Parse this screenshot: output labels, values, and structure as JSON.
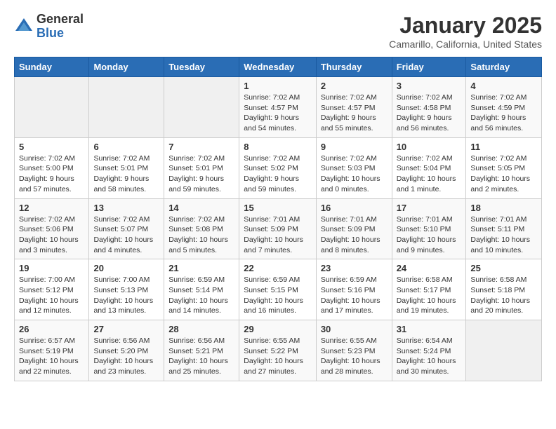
{
  "logo": {
    "general": "General",
    "blue": "Blue"
  },
  "header": {
    "title": "January 2025",
    "location": "Camarillo, California, United States"
  },
  "days_of_week": [
    "Sunday",
    "Monday",
    "Tuesday",
    "Wednesday",
    "Thursday",
    "Friday",
    "Saturday"
  ],
  "weeks": [
    [
      {
        "day": "",
        "info": ""
      },
      {
        "day": "",
        "info": ""
      },
      {
        "day": "",
        "info": ""
      },
      {
        "day": "1",
        "info": "Sunrise: 7:02 AM\nSunset: 4:57 PM\nDaylight: 9 hours\nand 54 minutes."
      },
      {
        "day": "2",
        "info": "Sunrise: 7:02 AM\nSunset: 4:57 PM\nDaylight: 9 hours\nand 55 minutes."
      },
      {
        "day": "3",
        "info": "Sunrise: 7:02 AM\nSunset: 4:58 PM\nDaylight: 9 hours\nand 56 minutes."
      },
      {
        "day": "4",
        "info": "Sunrise: 7:02 AM\nSunset: 4:59 PM\nDaylight: 9 hours\nand 56 minutes."
      }
    ],
    [
      {
        "day": "5",
        "info": "Sunrise: 7:02 AM\nSunset: 5:00 PM\nDaylight: 9 hours\nand 57 minutes."
      },
      {
        "day": "6",
        "info": "Sunrise: 7:02 AM\nSunset: 5:01 PM\nDaylight: 9 hours\nand 58 minutes."
      },
      {
        "day": "7",
        "info": "Sunrise: 7:02 AM\nSunset: 5:01 PM\nDaylight: 9 hours\nand 59 minutes."
      },
      {
        "day": "8",
        "info": "Sunrise: 7:02 AM\nSunset: 5:02 PM\nDaylight: 9 hours\nand 59 minutes."
      },
      {
        "day": "9",
        "info": "Sunrise: 7:02 AM\nSunset: 5:03 PM\nDaylight: 10 hours\nand 0 minutes."
      },
      {
        "day": "10",
        "info": "Sunrise: 7:02 AM\nSunset: 5:04 PM\nDaylight: 10 hours\nand 1 minute."
      },
      {
        "day": "11",
        "info": "Sunrise: 7:02 AM\nSunset: 5:05 PM\nDaylight: 10 hours\nand 2 minutes."
      }
    ],
    [
      {
        "day": "12",
        "info": "Sunrise: 7:02 AM\nSunset: 5:06 PM\nDaylight: 10 hours\nand 3 minutes."
      },
      {
        "day": "13",
        "info": "Sunrise: 7:02 AM\nSunset: 5:07 PM\nDaylight: 10 hours\nand 4 minutes."
      },
      {
        "day": "14",
        "info": "Sunrise: 7:02 AM\nSunset: 5:08 PM\nDaylight: 10 hours\nand 5 minutes."
      },
      {
        "day": "15",
        "info": "Sunrise: 7:01 AM\nSunset: 5:09 PM\nDaylight: 10 hours\nand 7 minutes."
      },
      {
        "day": "16",
        "info": "Sunrise: 7:01 AM\nSunset: 5:09 PM\nDaylight: 10 hours\nand 8 minutes."
      },
      {
        "day": "17",
        "info": "Sunrise: 7:01 AM\nSunset: 5:10 PM\nDaylight: 10 hours\nand 9 minutes."
      },
      {
        "day": "18",
        "info": "Sunrise: 7:01 AM\nSunset: 5:11 PM\nDaylight: 10 hours\nand 10 minutes."
      }
    ],
    [
      {
        "day": "19",
        "info": "Sunrise: 7:00 AM\nSunset: 5:12 PM\nDaylight: 10 hours\nand 12 minutes."
      },
      {
        "day": "20",
        "info": "Sunrise: 7:00 AM\nSunset: 5:13 PM\nDaylight: 10 hours\nand 13 minutes."
      },
      {
        "day": "21",
        "info": "Sunrise: 6:59 AM\nSunset: 5:14 PM\nDaylight: 10 hours\nand 14 minutes."
      },
      {
        "day": "22",
        "info": "Sunrise: 6:59 AM\nSunset: 5:15 PM\nDaylight: 10 hours\nand 16 minutes."
      },
      {
        "day": "23",
        "info": "Sunrise: 6:59 AM\nSunset: 5:16 PM\nDaylight: 10 hours\nand 17 minutes."
      },
      {
        "day": "24",
        "info": "Sunrise: 6:58 AM\nSunset: 5:17 PM\nDaylight: 10 hours\nand 19 minutes."
      },
      {
        "day": "25",
        "info": "Sunrise: 6:58 AM\nSunset: 5:18 PM\nDaylight: 10 hours\nand 20 minutes."
      }
    ],
    [
      {
        "day": "26",
        "info": "Sunrise: 6:57 AM\nSunset: 5:19 PM\nDaylight: 10 hours\nand 22 minutes."
      },
      {
        "day": "27",
        "info": "Sunrise: 6:56 AM\nSunset: 5:20 PM\nDaylight: 10 hours\nand 23 minutes."
      },
      {
        "day": "28",
        "info": "Sunrise: 6:56 AM\nSunset: 5:21 PM\nDaylight: 10 hours\nand 25 minutes."
      },
      {
        "day": "29",
        "info": "Sunrise: 6:55 AM\nSunset: 5:22 PM\nDaylight: 10 hours\nand 27 minutes."
      },
      {
        "day": "30",
        "info": "Sunrise: 6:55 AM\nSunset: 5:23 PM\nDaylight: 10 hours\nand 28 minutes."
      },
      {
        "day": "31",
        "info": "Sunrise: 6:54 AM\nSunset: 5:24 PM\nDaylight: 10 hours\nand 30 minutes."
      },
      {
        "day": "",
        "info": ""
      }
    ]
  ]
}
